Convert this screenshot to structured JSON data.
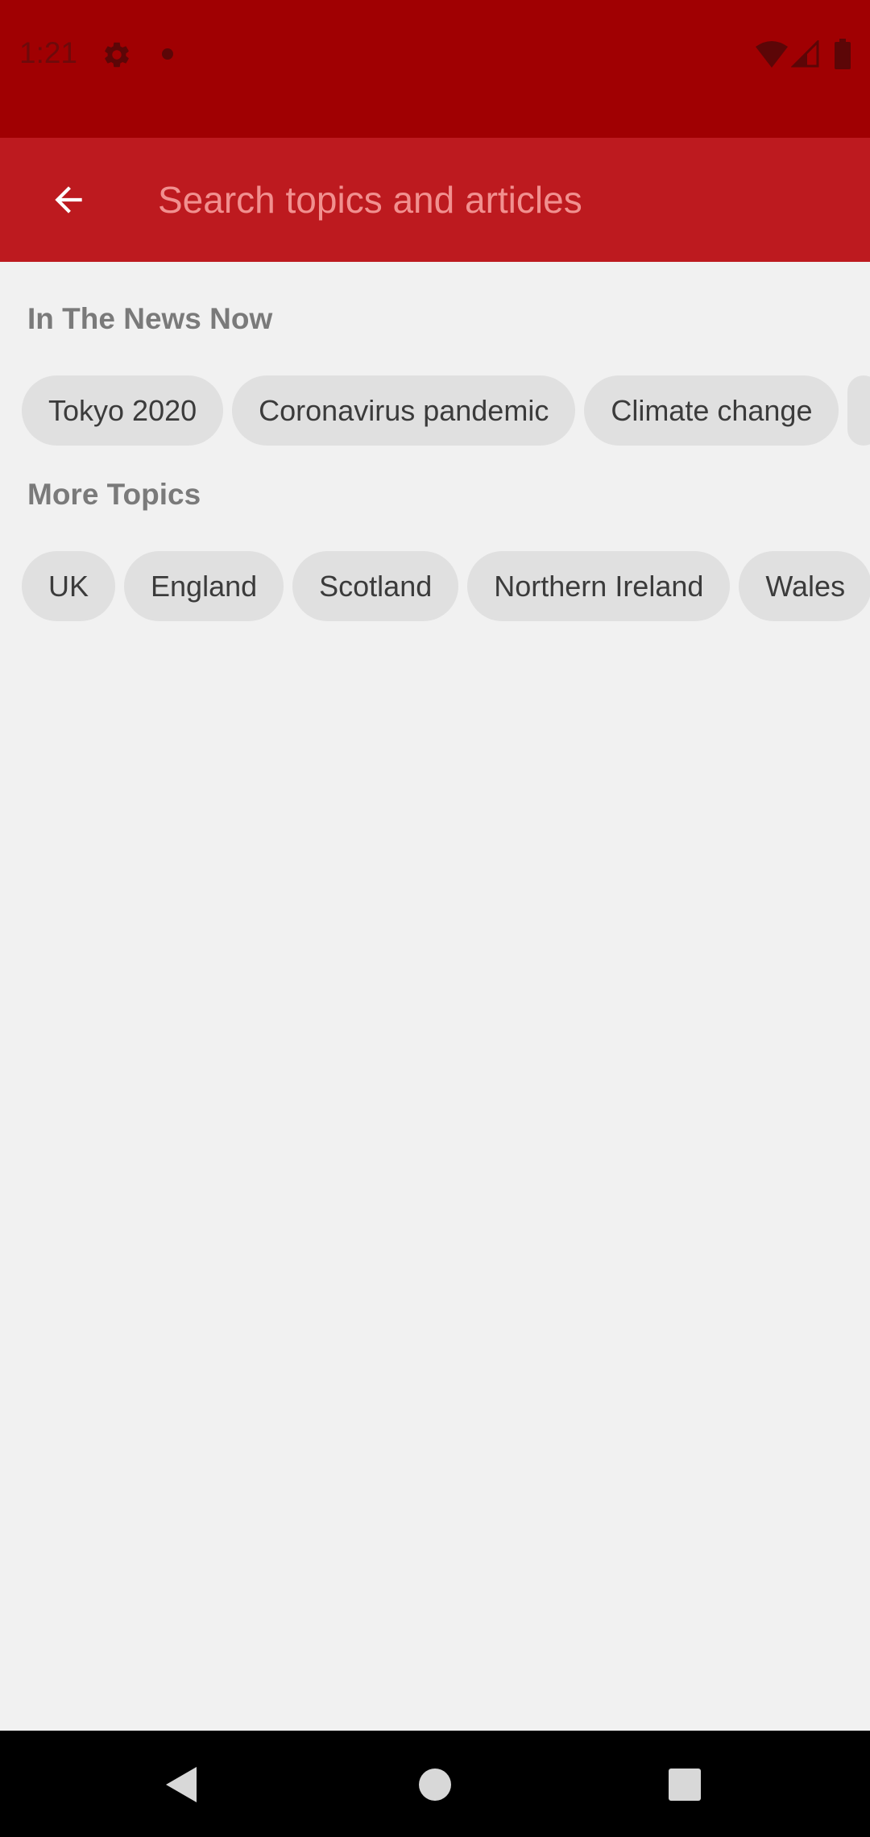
{
  "status_bar": {
    "time": "1:21",
    "icons": [
      "gear-icon",
      "notification-dot-icon",
      "wifi-icon",
      "signal-icon",
      "battery-icon"
    ],
    "background_color": "#a00002"
  },
  "app_bar": {
    "back_icon": "arrow-left-icon",
    "search_placeholder": "Search topics and articles",
    "search_value": "",
    "background_color": "#bd1a1f"
  },
  "sections": [
    {
      "heading": "In The News Now",
      "chips": [
        "Tokyo 2020",
        "Coronavirus pandemic",
        "Climate change"
      ]
    },
    {
      "heading": "More Topics",
      "chips": [
        "UK",
        "England",
        "Scotland",
        "Northern Ireland",
        "Wales"
      ]
    }
  ],
  "nav_bar": {
    "buttons": [
      "back-triangle-icon",
      "home-circle-icon",
      "recents-square-icon"
    ]
  }
}
